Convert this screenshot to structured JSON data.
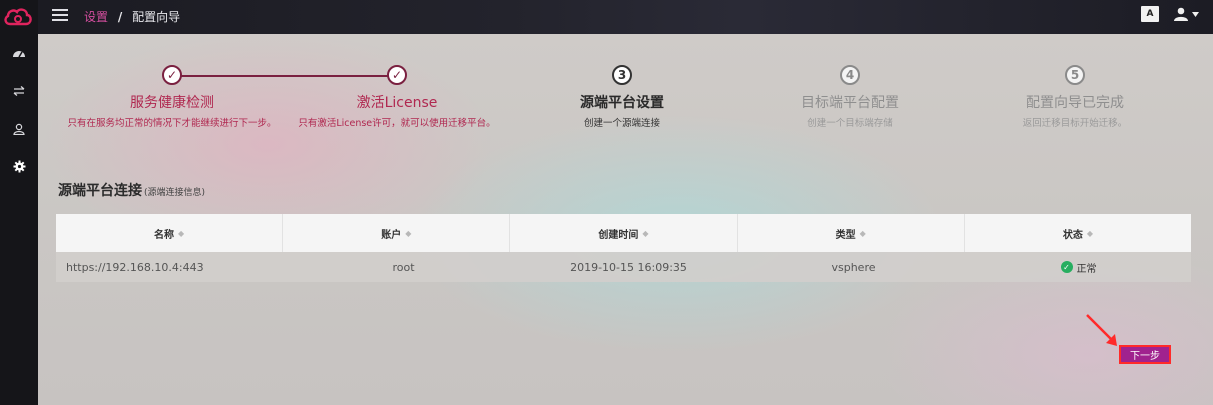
{
  "header": {
    "breadcrumb_parent": "设置",
    "breadcrumb_sep": "/",
    "breadcrumb_current": "配置向导",
    "lang_label": "A"
  },
  "steps": [
    {
      "number": "✓",
      "title": "服务健康检测",
      "desc": "只有在服务均正常的情况下才能继续进行下一步。",
      "state": "done"
    },
    {
      "number": "✓",
      "title": "激活License",
      "desc": "只有激活License许可，就可以使用迁移平台。",
      "state": "done"
    },
    {
      "number": "3",
      "title": "源端平台设置",
      "desc": "创建一个源端连接",
      "state": "active"
    },
    {
      "number": "4",
      "title": "目标端平台配置",
      "desc": "创建一个目标端存储",
      "state": "todo"
    },
    {
      "number": "5",
      "title": "配置向导已完成",
      "desc": "返回迁移目标开始迁移。",
      "state": "todo"
    }
  ],
  "section": {
    "title": "源端平台连接",
    "subtitle": "(源端连接信息)"
  },
  "table": {
    "columns": [
      "名称",
      "账户",
      "创建时间",
      "类型",
      "状态"
    ],
    "rows": [
      {
        "name": "https://192.168.10.4:443",
        "account": "root",
        "created": "2019-10-15 16:09:35",
        "type": "vsphere",
        "status": "正常"
      }
    ]
  },
  "actions": {
    "next_label": "下一步"
  },
  "colors": {
    "brand": "#a0228e",
    "step_done": "#7a2040",
    "status_ok": "#27ae60",
    "highlight": "#ff2a2a"
  }
}
